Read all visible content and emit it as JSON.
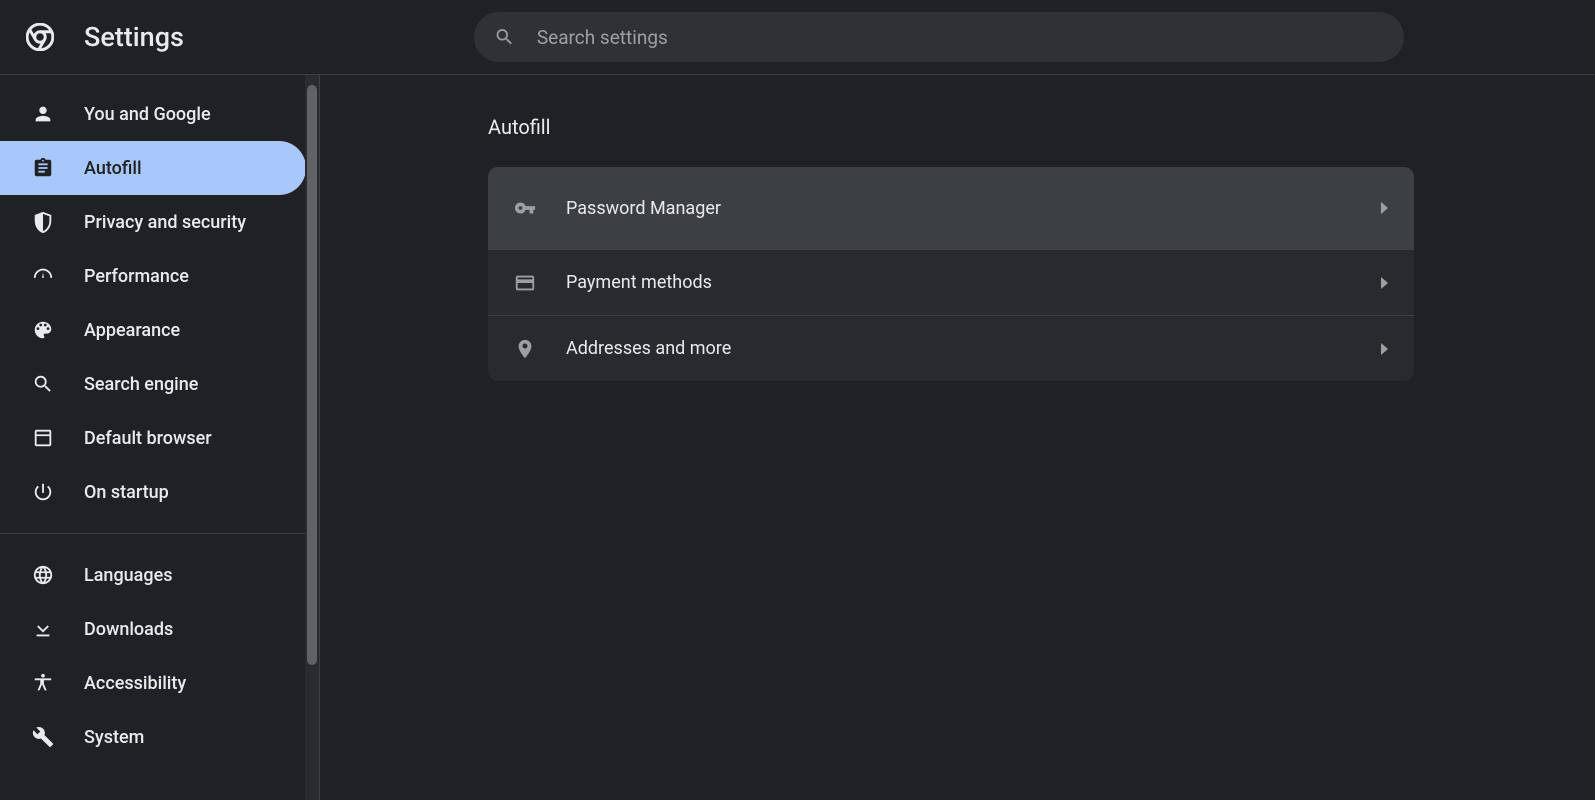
{
  "header": {
    "title": "Settings",
    "search_placeholder": "Search settings"
  },
  "sidebar": {
    "items": [
      {
        "id": "you-and-google",
        "label": "You and Google",
        "icon": "person"
      },
      {
        "id": "autofill",
        "label": "Autofill",
        "icon": "assignment",
        "selected": true
      },
      {
        "id": "privacy-security",
        "label": "Privacy and security",
        "icon": "shield"
      },
      {
        "id": "performance",
        "label": "Performance",
        "icon": "speedometer"
      },
      {
        "id": "appearance",
        "label": "Appearance",
        "icon": "palette"
      },
      {
        "id": "search-engine",
        "label": "Search engine",
        "icon": "search"
      },
      {
        "id": "default-browser",
        "label": "Default browser",
        "icon": "browser"
      },
      {
        "id": "on-startup",
        "label": "On startup",
        "icon": "power"
      }
    ],
    "items2": [
      {
        "id": "languages",
        "label": "Languages",
        "icon": "globe"
      },
      {
        "id": "downloads",
        "label": "Downloads",
        "icon": "download"
      },
      {
        "id": "accessibility",
        "label": "Accessibility",
        "icon": "accessibility"
      },
      {
        "id": "system",
        "label": "System",
        "icon": "wrench"
      }
    ]
  },
  "main": {
    "section_title": "Autofill",
    "rows": [
      {
        "id": "password-manager",
        "label": "Password Manager",
        "icon": "key",
        "hover": true,
        "tall": true
      },
      {
        "id": "payment-methods",
        "label": "Payment methods",
        "icon": "card"
      },
      {
        "id": "addresses",
        "label": "Addresses and more",
        "icon": "location"
      }
    ]
  }
}
